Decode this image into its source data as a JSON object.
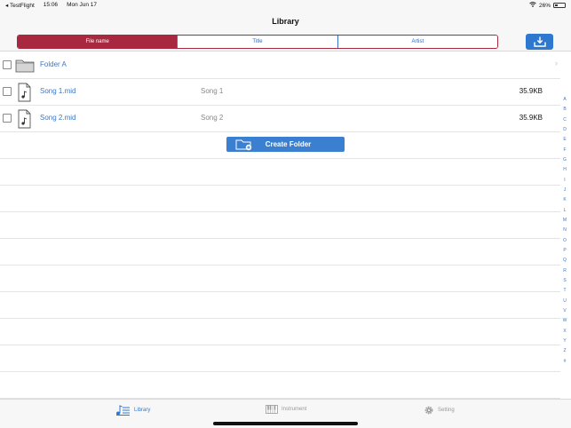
{
  "status": {
    "carrier": "◂ TestFlight",
    "time": "15:06",
    "date": "Mon Jun 17",
    "battery": "26%"
  },
  "nav": {
    "title": "Library"
  },
  "segments": {
    "items": [
      "File name",
      "Title",
      "Artist"
    ],
    "active": "File name"
  },
  "files": [
    {
      "name": "Folder A",
      "type": "folder",
      "title": "",
      "size": ""
    },
    {
      "name": "Song 1.mid",
      "type": "midi",
      "title": "Song 1",
      "size": "35.9KB"
    },
    {
      "name": "Song 2.mid",
      "type": "midi",
      "title": "Song 2",
      "size": "35.9KB"
    }
  ],
  "create_folder_label": "Create Folder",
  "index_letters": [
    "A",
    "B",
    "C",
    "D",
    "E",
    "F",
    "G",
    "H",
    "I",
    "J",
    "K",
    "L",
    "M",
    "N",
    "O",
    "P",
    "Q",
    "R",
    "S",
    "T",
    "U",
    "V",
    "W",
    "X",
    "Y",
    "Z",
    "#"
  ],
  "tabs": {
    "library": "Library",
    "instrument": "Instrument",
    "setting": "Setting"
  },
  "colors": {
    "accent": "#2f78cf",
    "segment_active": "#a8293f",
    "link": "#3a78c9"
  },
  "icons": {
    "download": "download-tray-icon",
    "folder": "folder-icon",
    "midi": "music-file-icon",
    "create_folder": "folder-plus-icon",
    "library_tab": "music-list-icon",
    "instrument_tab": "piano-icon",
    "setting_tab": "gear-icon"
  }
}
